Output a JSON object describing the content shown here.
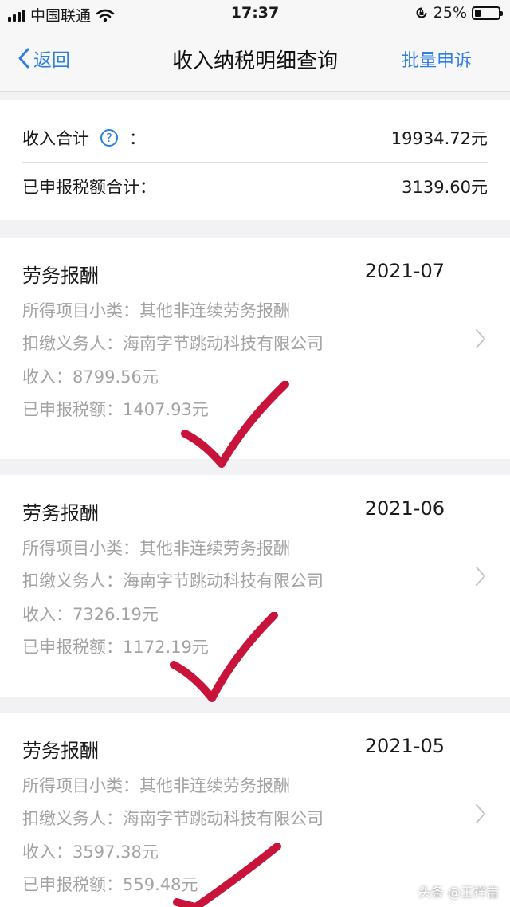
{
  "status": {
    "carrier": "中国联通",
    "time": "17:37",
    "battery_percent": "25%",
    "battery_level": 0.25
  },
  "nav": {
    "back_label": "返回",
    "title": "收入纳税明细查询",
    "action_label": "批量申诉"
  },
  "summary": {
    "income_label": "收入合计",
    "colon": "：",
    "income_value": "19934.72元",
    "tax_label": "已申报税额合计：",
    "tax_value": "3139.60元"
  },
  "records": [
    {
      "title": "劳务报酬",
      "period": "2021-07",
      "subcategory": "所得项目小类：其他非连续劳务报酬",
      "withholder": "扣缴义务人：海南字节跳动科技有限公司",
      "income": "收入：8799.56元",
      "tax": "已申报税额：1407.93元"
    },
    {
      "title": "劳务报酬",
      "period": "2021-06",
      "subcategory": "所得项目小类：其他非连续劳务报酬",
      "withholder": "扣缴义务人：海南字节跳动科技有限公司",
      "income": "收入：7326.19元",
      "tax": "已申报税额：1172.19元"
    },
    {
      "title": "劳务报酬",
      "period": "2021-05",
      "subcategory": "所得项目小类：其他非连续劳务报酬",
      "withholder": "扣缴义务人：海南字节跳动科技有限公司",
      "income": "收入：3597.38元",
      "tax": "已申报税额：559.48元"
    }
  ],
  "watermark": "头条 @王祥吉",
  "colors": {
    "accent": "#2f7ee6",
    "check_mark": "#c8143a",
    "secondary_text": "#a3a3a3"
  },
  "icons": {
    "back": "chevron-left-icon",
    "help": "question-circle-icon",
    "row_arrow": "chevron-right-icon",
    "check": "handwritten-check-icon"
  }
}
